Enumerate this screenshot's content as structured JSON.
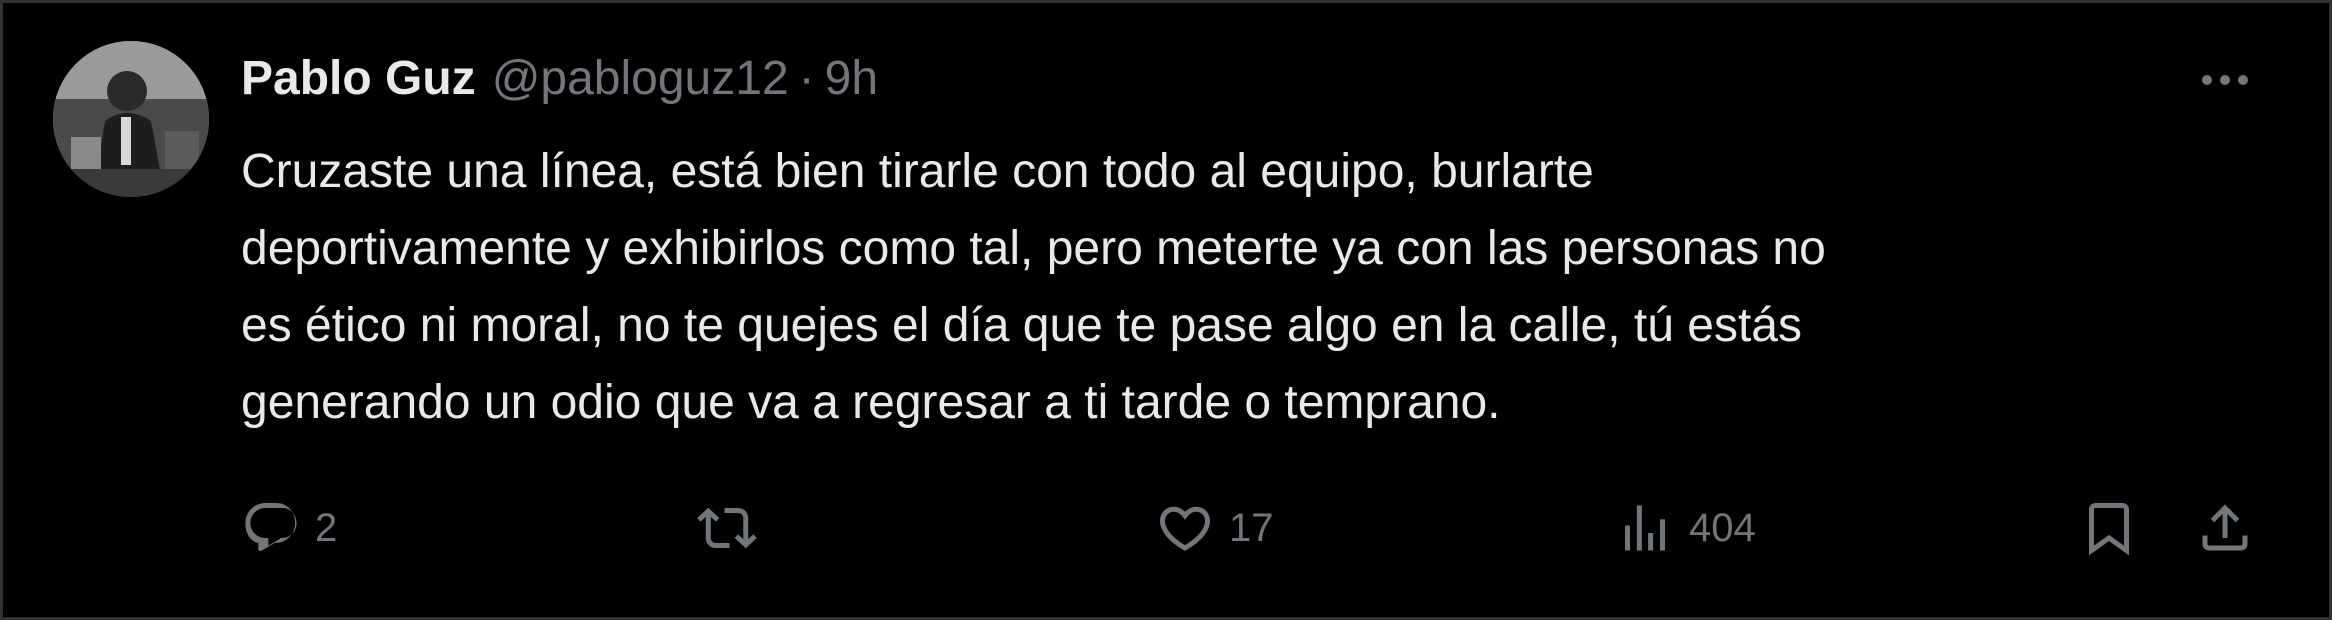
{
  "tweet": {
    "author": {
      "display_name": "Pablo Guz",
      "handle": "@pabloguz12",
      "avatar_icon": "profile-photo"
    },
    "separator": "·",
    "time": "9h",
    "text_lines": [
      "Cruzaste una línea, está bien tirarle con todo al equipo, burlarte",
      "deportivamente y exhibirlos como tal, pero meterte ya con las personas no",
      "es ético ni moral, no te quejes el día que te pase algo en la calle, tú estás",
      "generando un odio que va a regresar a ti tarde o temprano."
    ],
    "actions": {
      "reply": {
        "icon": "reply-icon",
        "count": "2"
      },
      "retweet": {
        "icon": "retweet-icon",
        "count": ""
      },
      "like": {
        "icon": "heart-icon",
        "count": "17"
      },
      "views": {
        "icon": "views-icon",
        "count": "404"
      },
      "bookmark": {
        "icon": "bookmark-icon"
      },
      "share": {
        "icon": "share-icon"
      }
    }
  },
  "colors": {
    "background": "#000000",
    "text_primary": "#e7e9ea",
    "text_secondary": "#71767b",
    "border": "#2f3336"
  }
}
